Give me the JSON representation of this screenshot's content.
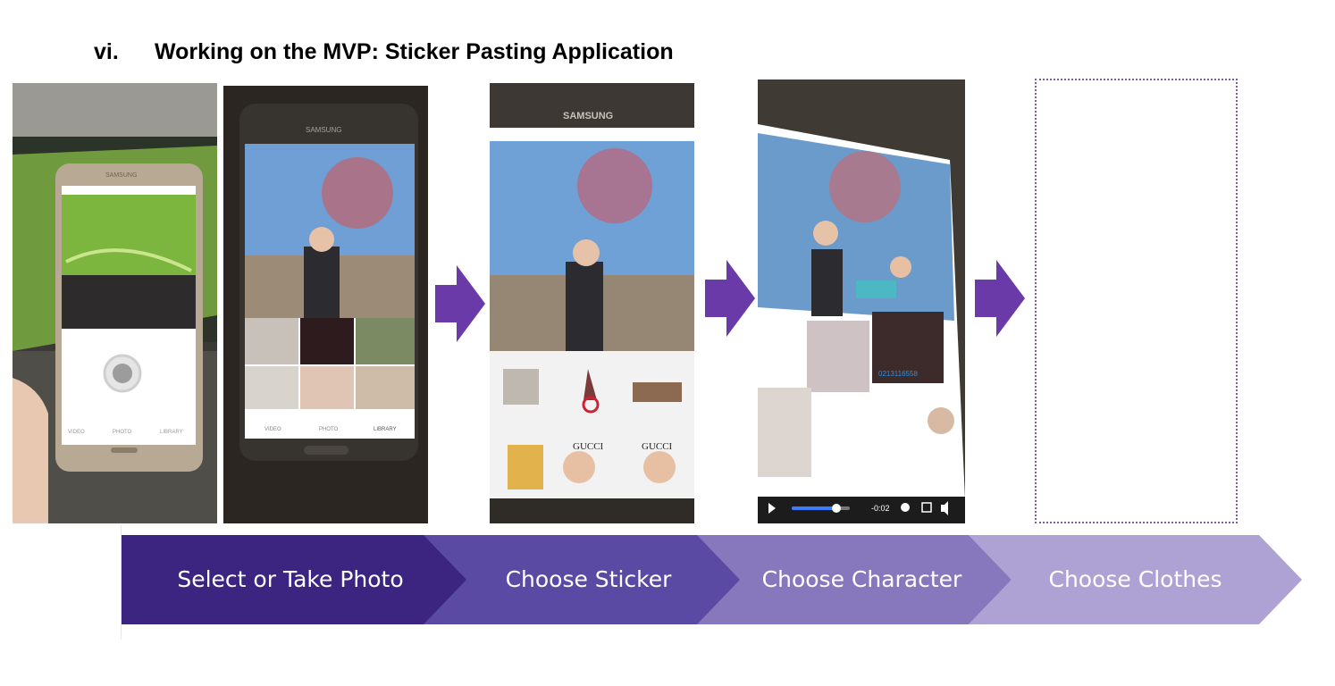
{
  "heading": {
    "number": "vi.",
    "title": "Working on the MVP: Sticker Pasting Application"
  },
  "colors": {
    "arrow": "#6a3aa8",
    "step1": "#3b2580",
    "step2": "#5b4aa3",
    "step3": "#8777bd",
    "step4": "#ada2d3",
    "placeholder_border": "#7b5aa6"
  },
  "screens": {
    "phone1": {
      "brand": "SAMSUNG",
      "tabs": [
        "VIDEO",
        "PHOTO",
        "LIBRARY"
      ]
    },
    "phone2": {
      "brand": "SAMSUNG",
      "tabs": [
        "VIDEO",
        "PHOTO",
        "LIBRARY"
      ]
    },
    "phone3": {
      "brand": "SAMSUNG",
      "sticker_text_1": "GUCCI",
      "sticker_text_2": "GUCCI"
    },
    "phone4": {
      "time_remaining": "-0:02",
      "number_text": "0213116558"
    }
  },
  "steps": [
    {
      "label": "Select or Take Photo"
    },
    {
      "label": "Choose Sticker"
    },
    {
      "label": "Choose Character"
    },
    {
      "label": "Choose Clothes"
    }
  ]
}
